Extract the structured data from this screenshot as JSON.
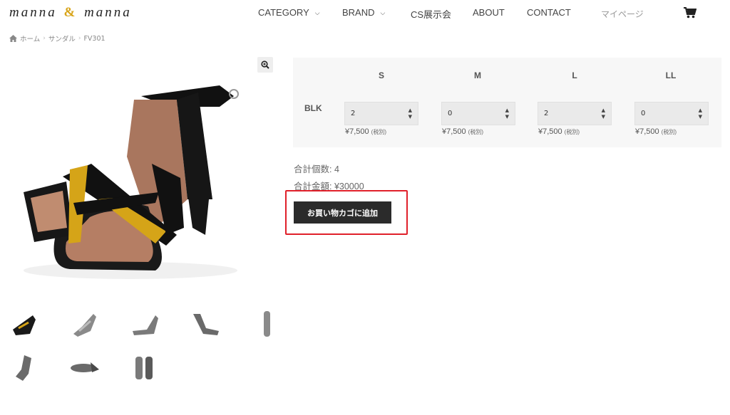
{
  "header": {
    "logo_left": "manna",
    "logo_right": "manna",
    "logo_mark": "&",
    "nav": [
      {
        "label": "CATEGORY",
        "has_dropdown": true
      },
      {
        "label": "BRAND",
        "has_dropdown": true
      },
      {
        "label": "CS展示会",
        "has_dropdown": false
      },
      {
        "label": "ABOUT",
        "has_dropdown": false
      },
      {
        "label": "CONTACT",
        "has_dropdown": false
      }
    ],
    "mypage": "マイページ",
    "dropdown_glyph": "❯",
    "cart_icon": "cart-icon"
  },
  "breadcrumb": {
    "home": "ホーム",
    "category": "サンダル",
    "current": "FV301",
    "separator": "›"
  },
  "product": {
    "zoom_icon": "zoom-icon",
    "thumbnail_count": 8
  },
  "variants": {
    "sizes": [
      "S",
      "M",
      "L",
      "LL"
    ],
    "color_label": "BLK",
    "quantities": [
      "2",
      "0",
      "2",
      "0"
    ],
    "prices": [
      "¥7,500",
      "¥7,500",
      "¥7,500",
      "¥7,500"
    ],
    "tax_note": "(税別)"
  },
  "totals": {
    "count_text": "合計個数: 4",
    "amount_text": "合計金額: ¥30000"
  },
  "add_to_cart": "お買い物カゴに追加",
  "colors": {
    "button_bg": "#2b2b2b",
    "highlight": "#e0202a",
    "gold": "#d8a419",
    "table_bg": "#f7f7f7"
  }
}
